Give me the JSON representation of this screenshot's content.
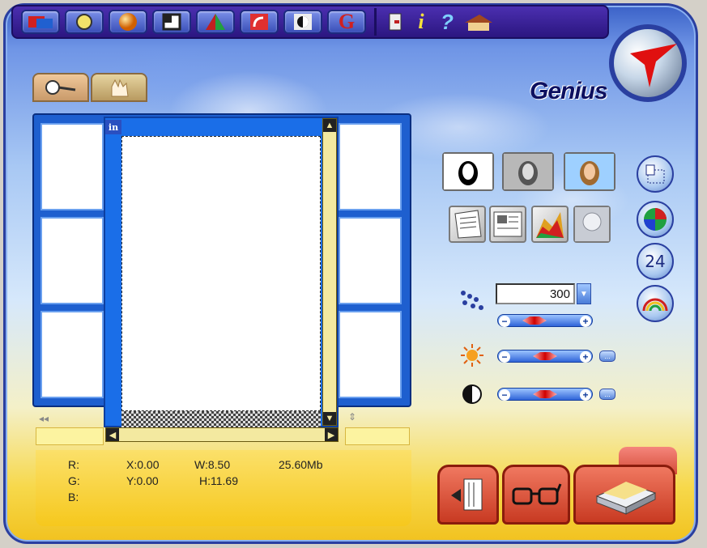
{
  "logo": {
    "text": "Genius"
  },
  "toolbar": {
    "buttons": [
      "scan-icon",
      "settings-icon",
      "sphere-icon",
      "frame-icon",
      "triangle-icon",
      "rotate-icon",
      "contrast-icon",
      "g-icon"
    ],
    "small": [
      "exit-icon",
      "info-icon",
      "help-icon",
      "home-icon"
    ],
    "info_glyph": "i",
    "help_glyph": "?",
    "g_glyph": "G"
  },
  "tabs": [
    {
      "icon": "magnifier-icon"
    },
    {
      "icon": "hand-icon"
    }
  ],
  "preview": {
    "in_label": "in"
  },
  "info": {
    "r_label": "R:",
    "g_label": "G:",
    "b_label": "B:",
    "x": "X:0.00",
    "y": "Y:0.00",
    "w": "W:8.50",
    "h": "H:11.69",
    "size": "25.60Mb"
  },
  "controls": {
    "resolution": "300",
    "resolution_slider": 0.25,
    "brightness_slider": 0.5,
    "contrast_slider": 0.5,
    "dots_label": "...",
    "side_24": "24"
  },
  "colors": {
    "accent": "#2a3fa0",
    "action": "#d44c38"
  }
}
